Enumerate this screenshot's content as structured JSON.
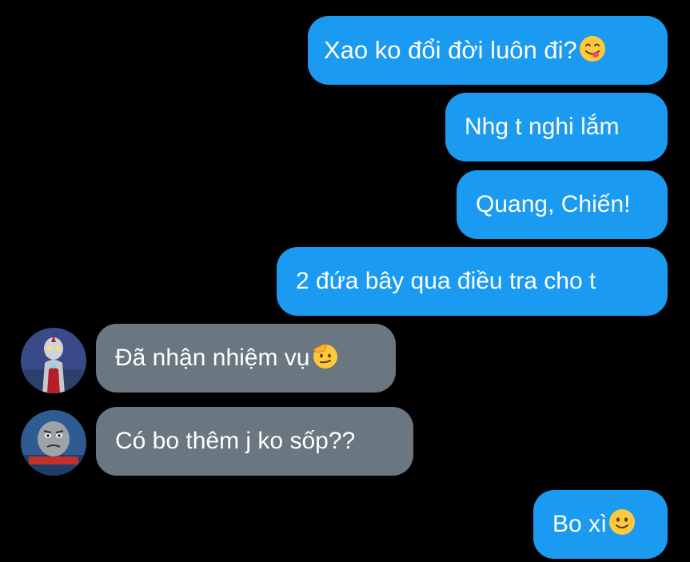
{
  "messages": [
    {
      "text": "Xao ko đổi đời luôn đi?",
      "emoji": "face-savoring-food-emoji"
    },
    {
      "text": "Nhg t nghi lắm"
    },
    {
      "text": "Quang, Chiến!"
    },
    {
      "text": "2 đứa bây qua điều tra cho t"
    },
    {
      "text": "Đã nhận nhiệm vụ",
      "emoji": "saluting-face-emoji",
      "sender_avatar": "ultraman-avatar"
    },
    {
      "text": "Có bo thêm j ko sốp??",
      "sender_avatar": "tank-engine-avatar"
    },
    {
      "text": "Bo xì",
      "emoji": "slightly-smiling-face-emoji"
    }
  ],
  "colors": {
    "background": "#000000",
    "outgoing_bubble": "#1a9af1",
    "incoming_bubble": "#6a7680",
    "text": "#ffffff"
  }
}
